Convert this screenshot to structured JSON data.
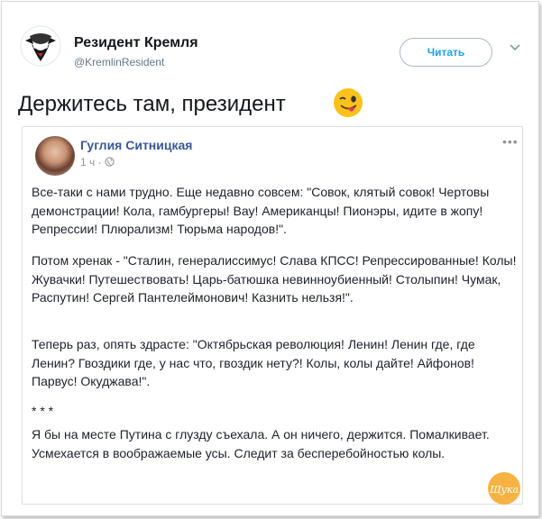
{
  "tweet": {
    "author_name": "Резидент Кремля",
    "author_handle": "@KremlinResident",
    "follow_label": "Читать",
    "text": "Держитесь там, президент",
    "emoji": "winking-face-with-tongue-emoji"
  },
  "fb_post": {
    "author": "Гуглия Ситницкая",
    "time": "1 ч ·",
    "paragraphs": [
      "Все-таки с нами трудно. Еще недавно совсем: \"Совок, клятый совок! Чертовы демонстрации! Кола, гамбургеры! Вау! Американцы! Пионэры, идите в жопу! Репрессии! Плюрализм! Тюрьма народов!\".",
      "Потом хренак - \"Сталин, генералиссимус! Слава КПСС! Репрессированные! Колы! Жувачки! Путешествовать! Царь-батюшка невинноубиенный! Столыпин! Чумак, Распутин! Сергей Пантелеймонович! Казнить нельзя!\".",
      "Теперь раз, опять здрасте: \"Октябрьская революция! Ленин! Ленин где, где Ленин? Гвоздики где, у нас что, гвоздик нету?! Колы, колы дайте! Айфонов! Парвус! Окуджава!\".",
      "* * *",
      "Я бы на месте Путина с глузду съехала. А он ничего, держится. Помалкивает. Усмехается в воображаемые усы. Следит за бесперебойностью колы."
    ]
  },
  "watermark": {
    "text": "Шука"
  },
  "colors": {
    "link": "#385898",
    "follow": "#1da1f2",
    "watermark": "#f5a623"
  }
}
